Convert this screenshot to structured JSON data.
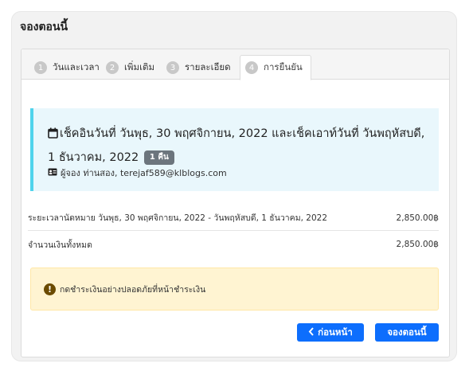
{
  "card": {
    "title": "จองตอนนี้"
  },
  "tabs": [
    {
      "num": "1",
      "label": "วันและเวลา",
      "active": false
    },
    {
      "num": "2",
      "label": "เพิ่มเติม",
      "active": false
    },
    {
      "num": "3",
      "label": "รายละเอียด",
      "active": false
    },
    {
      "num": "4",
      "label": "การยืนยัน",
      "active": true
    }
  ],
  "summary": {
    "checkin_text": "เช็คอินวันที่ วันพุธ, 30 พฤศจิกายน, 2022 และเช็คเอาท์วันที่ วันพฤหัสบดี, 1 ธันวาคม, 2022",
    "nights_badge": "1 คืน",
    "booker_text": "ผู้จอง ท่านสอง, terejaf589@klblogs.com"
  },
  "rows": [
    {
      "label": "ระยะเวลานัดหมาย วันพุธ, 30 พฤศจิกายน, 2022 - วันพฤหัสบดี, 1 ธันวาคม, 2022",
      "amount": "2,850.00฿"
    },
    {
      "label": "จำนวนเงินทั้งหมด",
      "amount": "2,850.00฿"
    }
  ],
  "notice": {
    "text": "กดชำระเงินอย่างปลอดภัยที่หน้าชำระเงิน"
  },
  "buttons": {
    "back_label": "ก่อนหน้า",
    "book_label": "จองตอนนี้"
  },
  "colors": {
    "accent": "#0d6efd",
    "info_bg": "#e9f7fc",
    "info_border": "#4fd3ec",
    "warning_bg": "#fff4d2",
    "badge": "#6c757d"
  },
  "icons": {
    "calendar": "calendar-icon",
    "id_card": "id-card-icon",
    "warning": "exclamation-circle-icon",
    "back": "chevron-left-icon"
  }
}
